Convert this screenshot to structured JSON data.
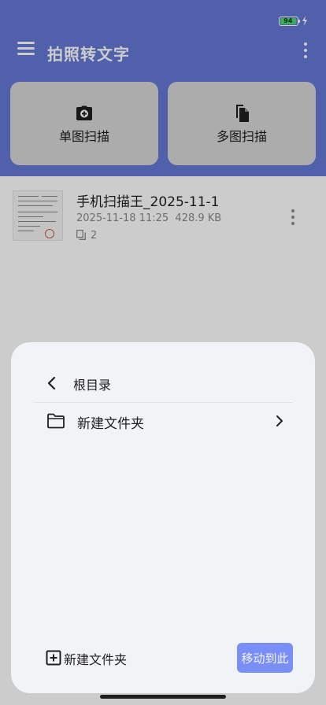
{
  "status_bar": {
    "battery_level": "94",
    "battery_fraction": 0.94,
    "charging": true
  },
  "app": {
    "title": "拍照转文字"
  },
  "toolbar": {
    "menu_icon": "hamburger-menu-icon",
    "more_icon": "more-vertical-icon"
  },
  "scan_cards": [
    {
      "label": "单图扫描",
      "icon": "camera-add-icon"
    },
    {
      "label": "多图扫描",
      "icon": "multi-page-icon"
    }
  ],
  "documents": [
    {
      "title": "手机扫描王_2025-11-1",
      "date": "2025-11-18 11:25",
      "size": "428.9 KB",
      "page_count": "2"
    }
  ],
  "sheet": {
    "breadcrumb": "根目录",
    "folders": [
      {
        "label": "新建文件夹"
      }
    ],
    "new_folder_label": "新建文件夹",
    "move_button_label": "移动到此"
  },
  "colors": {
    "header": "#6478d6",
    "card": "#d7d7d7",
    "sheet": "#f2f3f7",
    "primary_button": "#7a8ef7",
    "battery": "#4cd964"
  }
}
